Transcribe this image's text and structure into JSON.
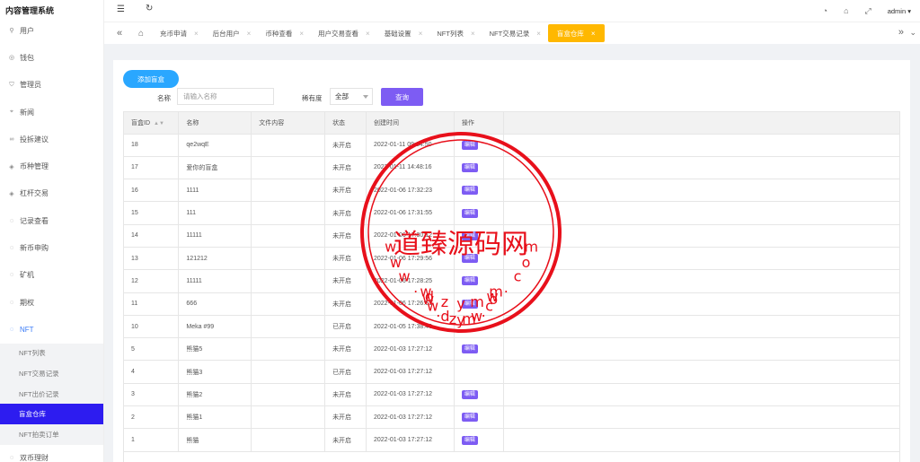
{
  "app": {
    "title": "内容管理系统",
    "user": "admin"
  },
  "sidebar": {
    "items": [
      {
        "label": "用户",
        "icon": "user-icon"
      },
      {
        "label": "钱包",
        "icon": "wallet-icon"
      },
      {
        "label": "管理员",
        "icon": "shield-icon"
      },
      {
        "label": "新闻",
        "icon": "tag-icon"
      },
      {
        "label": "投拆建议",
        "icon": "link-icon"
      },
      {
        "label": "币种管理",
        "icon": "diamond-icon"
      },
      {
        "label": "杠杆交易",
        "icon": "diamond-icon"
      },
      {
        "label": "记录查看",
        "icon": "coin-icon"
      },
      {
        "label": "新币申购",
        "icon": "coin-icon"
      },
      {
        "label": "矿机",
        "icon": "coin-icon"
      },
      {
        "label": "期权",
        "icon": "coin-icon"
      },
      {
        "label": "NFT",
        "icon": "coin-icon"
      }
    ],
    "nft_sub": [
      "NFT列表",
      "NFT交易记录",
      "NFT出价记录",
      "盲盒仓库",
      "NFT拍卖订单"
    ],
    "after": {
      "label": "双币理财",
      "icon": "coin-icon"
    }
  },
  "tabs": [
    "充币申请",
    "后台用户",
    "币种查看",
    "用户交易查看",
    "基础设置",
    "NFT列表",
    "NFT交易记录",
    "盲盒仓库"
  ],
  "toolbar": {
    "add_label": "添加盲盒",
    "name_label": "名称",
    "name_placeholder": "请输入名称",
    "rarity_label": "稀有度",
    "rarity_value": "全部",
    "search_label": "查询"
  },
  "table": {
    "headers": [
      "盲盒ID",
      "名称",
      "文件内容",
      "状态",
      "创建时间",
      "操作"
    ],
    "edit_label": "编辑",
    "rows": [
      {
        "id": "18",
        "name": "qe2wqE",
        "file": "",
        "status": "未开启",
        "time": "2022-01-11 09:34:50",
        "edit": true
      },
      {
        "id": "17",
        "name": "爱你的盲盒",
        "file": "",
        "status": "未开启",
        "time": "2022-01-11 14:48:16",
        "edit": true
      },
      {
        "id": "16",
        "name": "1111",
        "file": "",
        "status": "未开启",
        "time": "2022-01-06 17:32:23",
        "edit": true
      },
      {
        "id": "15",
        "name": "111",
        "file": "",
        "status": "未开启",
        "time": "2022-01-06 17:31:55",
        "edit": true
      },
      {
        "id": "14",
        "name": "11111",
        "file": "",
        "status": "未开启",
        "time": "2022-01-06 17:30:12",
        "edit": true
      },
      {
        "id": "13",
        "name": "121212",
        "file": "",
        "status": "未开启",
        "time": "2022-01-06 17:29:56",
        "edit": true
      },
      {
        "id": "12",
        "name": "11111",
        "file": "",
        "status": "未开启",
        "time": "2022-01-06 17:28:25",
        "edit": true
      },
      {
        "id": "11",
        "name": "666",
        "file": "",
        "status": "未开启",
        "time": "2022-01-06 17:26:51",
        "edit": true
      },
      {
        "id": "10",
        "name": "Meka #99",
        "file": "",
        "status": "已开启",
        "time": "2022-01-05 17:38:40",
        "edit": false
      },
      {
        "id": "5",
        "name": "熊猫5",
        "file": "",
        "status": "未开启",
        "time": "2022-01-03 17:27:12",
        "edit": true
      },
      {
        "id": "4",
        "name": "熊猫3",
        "file": "",
        "status": "已开启",
        "time": "2022-01-03 17:27:12",
        "edit": false
      },
      {
        "id": "3",
        "name": "熊猫2",
        "file": "",
        "status": "未开启",
        "time": "2022-01-03 17:27:12",
        "edit": true
      },
      {
        "id": "2",
        "name": "熊猫1",
        "file": "",
        "status": "未开启",
        "time": "2022-01-03 17:27:12",
        "edit": true
      },
      {
        "id": "1",
        "name": "熊猫",
        "file": "",
        "status": "未开启",
        "time": "2022-01-03 17:27:12",
        "edit": true
      }
    ]
  },
  "watermark": {
    "main": "道臻源码网",
    "top_arc": [
      "w",
      "w",
      "w",
      ".",
      "d",
      "z",
      "y",
      "m",
      "w",
      ".",
      "c",
      "o",
      "m"
    ],
    "bottom_arc": [
      "w",
      "w",
      "w",
      ".",
      "d",
      "z",
      "y",
      "m",
      "w",
      ".",
      "c",
      "o",
      "m"
    ],
    "color": "#e8101b"
  },
  "colors": {
    "accent": "#2d1cf0",
    "tab_active": "#ffb800",
    "add_button": "#2aa7ff",
    "edit": "#7d5cf3"
  }
}
